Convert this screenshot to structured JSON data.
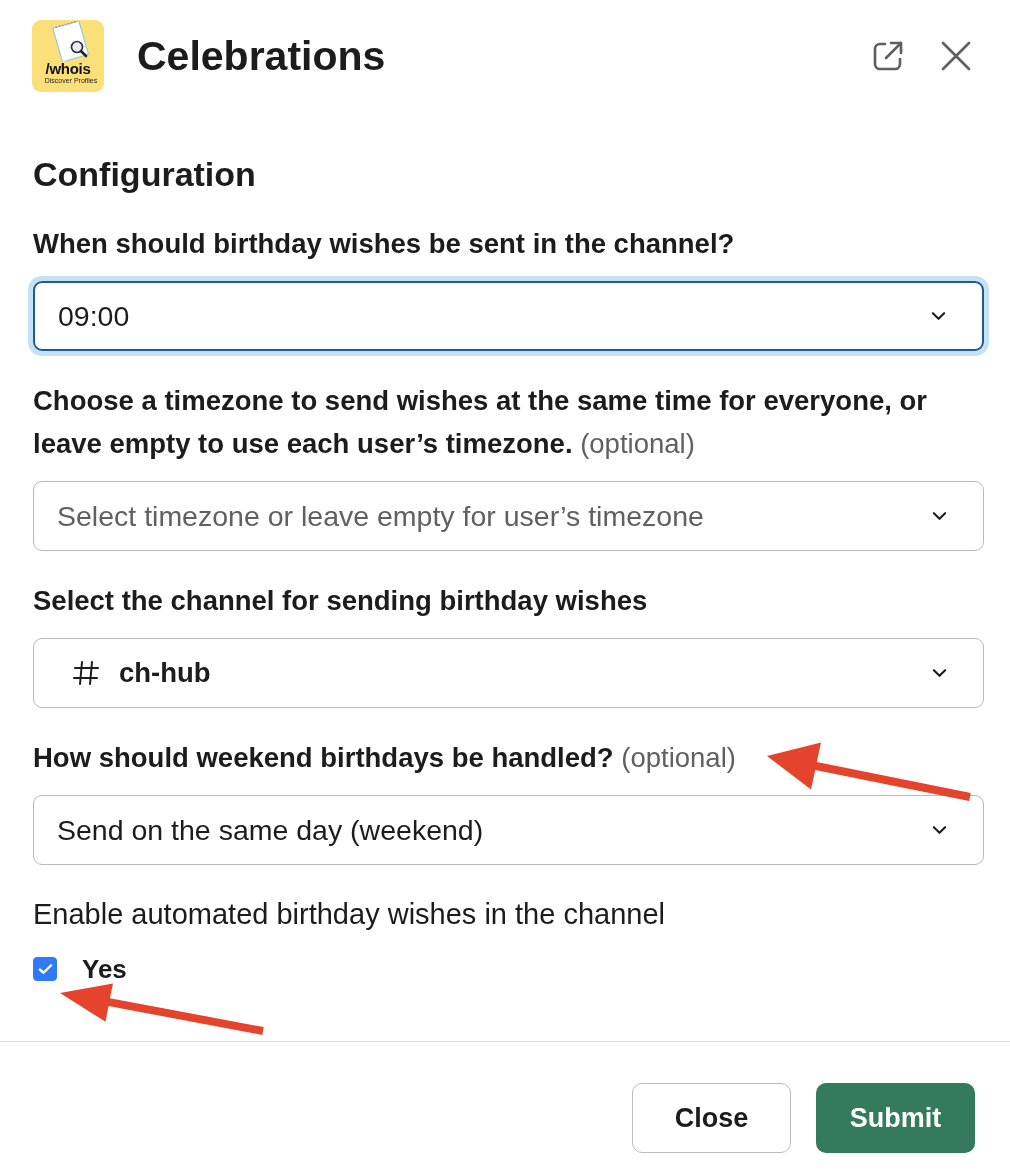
{
  "dialog": {
    "app_logo": {
      "name": "/whois",
      "tagline": "Discover Profiles"
    },
    "title": "Celebrations"
  },
  "section_title": "Configuration",
  "fields": [
    {
      "label": "When should birthday wishes be sent in the channel?",
      "kind": "static_select",
      "value": "09:00",
      "focused": true
    },
    {
      "label": "Choose a timezone to send wishes at the same time for everyone, or leave empty to use each user’s timezone.",
      "hint": "(optional)",
      "kind": "static_select",
      "placeholder": "Select timezone or leave empty for user’s timezone",
      "focused": false
    },
    {
      "label": "Select the channel for sending birthday wishes",
      "kind": "channel_select",
      "value": "ch-hub",
      "focused": false
    },
    {
      "label": "How should weekend birthdays be handled?",
      "hint": "(optional)",
      "kind": "static_select",
      "value": "Send on the same day (weekend)",
      "focused": false
    }
  ],
  "checkbox_group": {
    "label": "Enable automated birthday wishes in the channel",
    "options": [
      {
        "label": "Yes",
        "checked": true
      }
    ]
  },
  "buttons": [
    {
      "label": "Close",
      "kind": "secondary"
    },
    {
      "label": "Submit",
      "kind": "primary"
    }
  ]
}
